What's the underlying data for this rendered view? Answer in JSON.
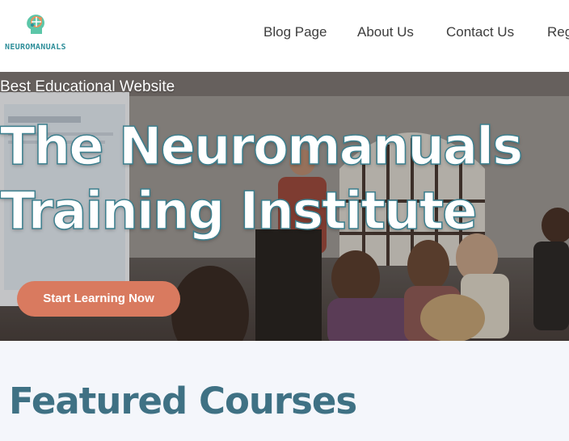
{
  "header": {
    "logo_text": "NEUROMANUALS",
    "logo_icon": "brain-head-icon",
    "nav": [
      {
        "label": "Blog Page"
      },
      {
        "label": "About Us"
      },
      {
        "label": "Contact Us"
      },
      {
        "label": "Reg"
      }
    ]
  },
  "hero": {
    "tagline": "Best Educational Website",
    "title_line1": "The Neuromanuals",
    "title_line2": "Training Institute",
    "cta_label": "Start Learning Now"
  },
  "featured": {
    "title": "Featured Courses"
  },
  "colors": {
    "brand_teal": "#3c7f8e",
    "cta_orange": "#d97a5f",
    "featured_heading": "#3f7184",
    "section_bg": "#f4f6fb"
  }
}
